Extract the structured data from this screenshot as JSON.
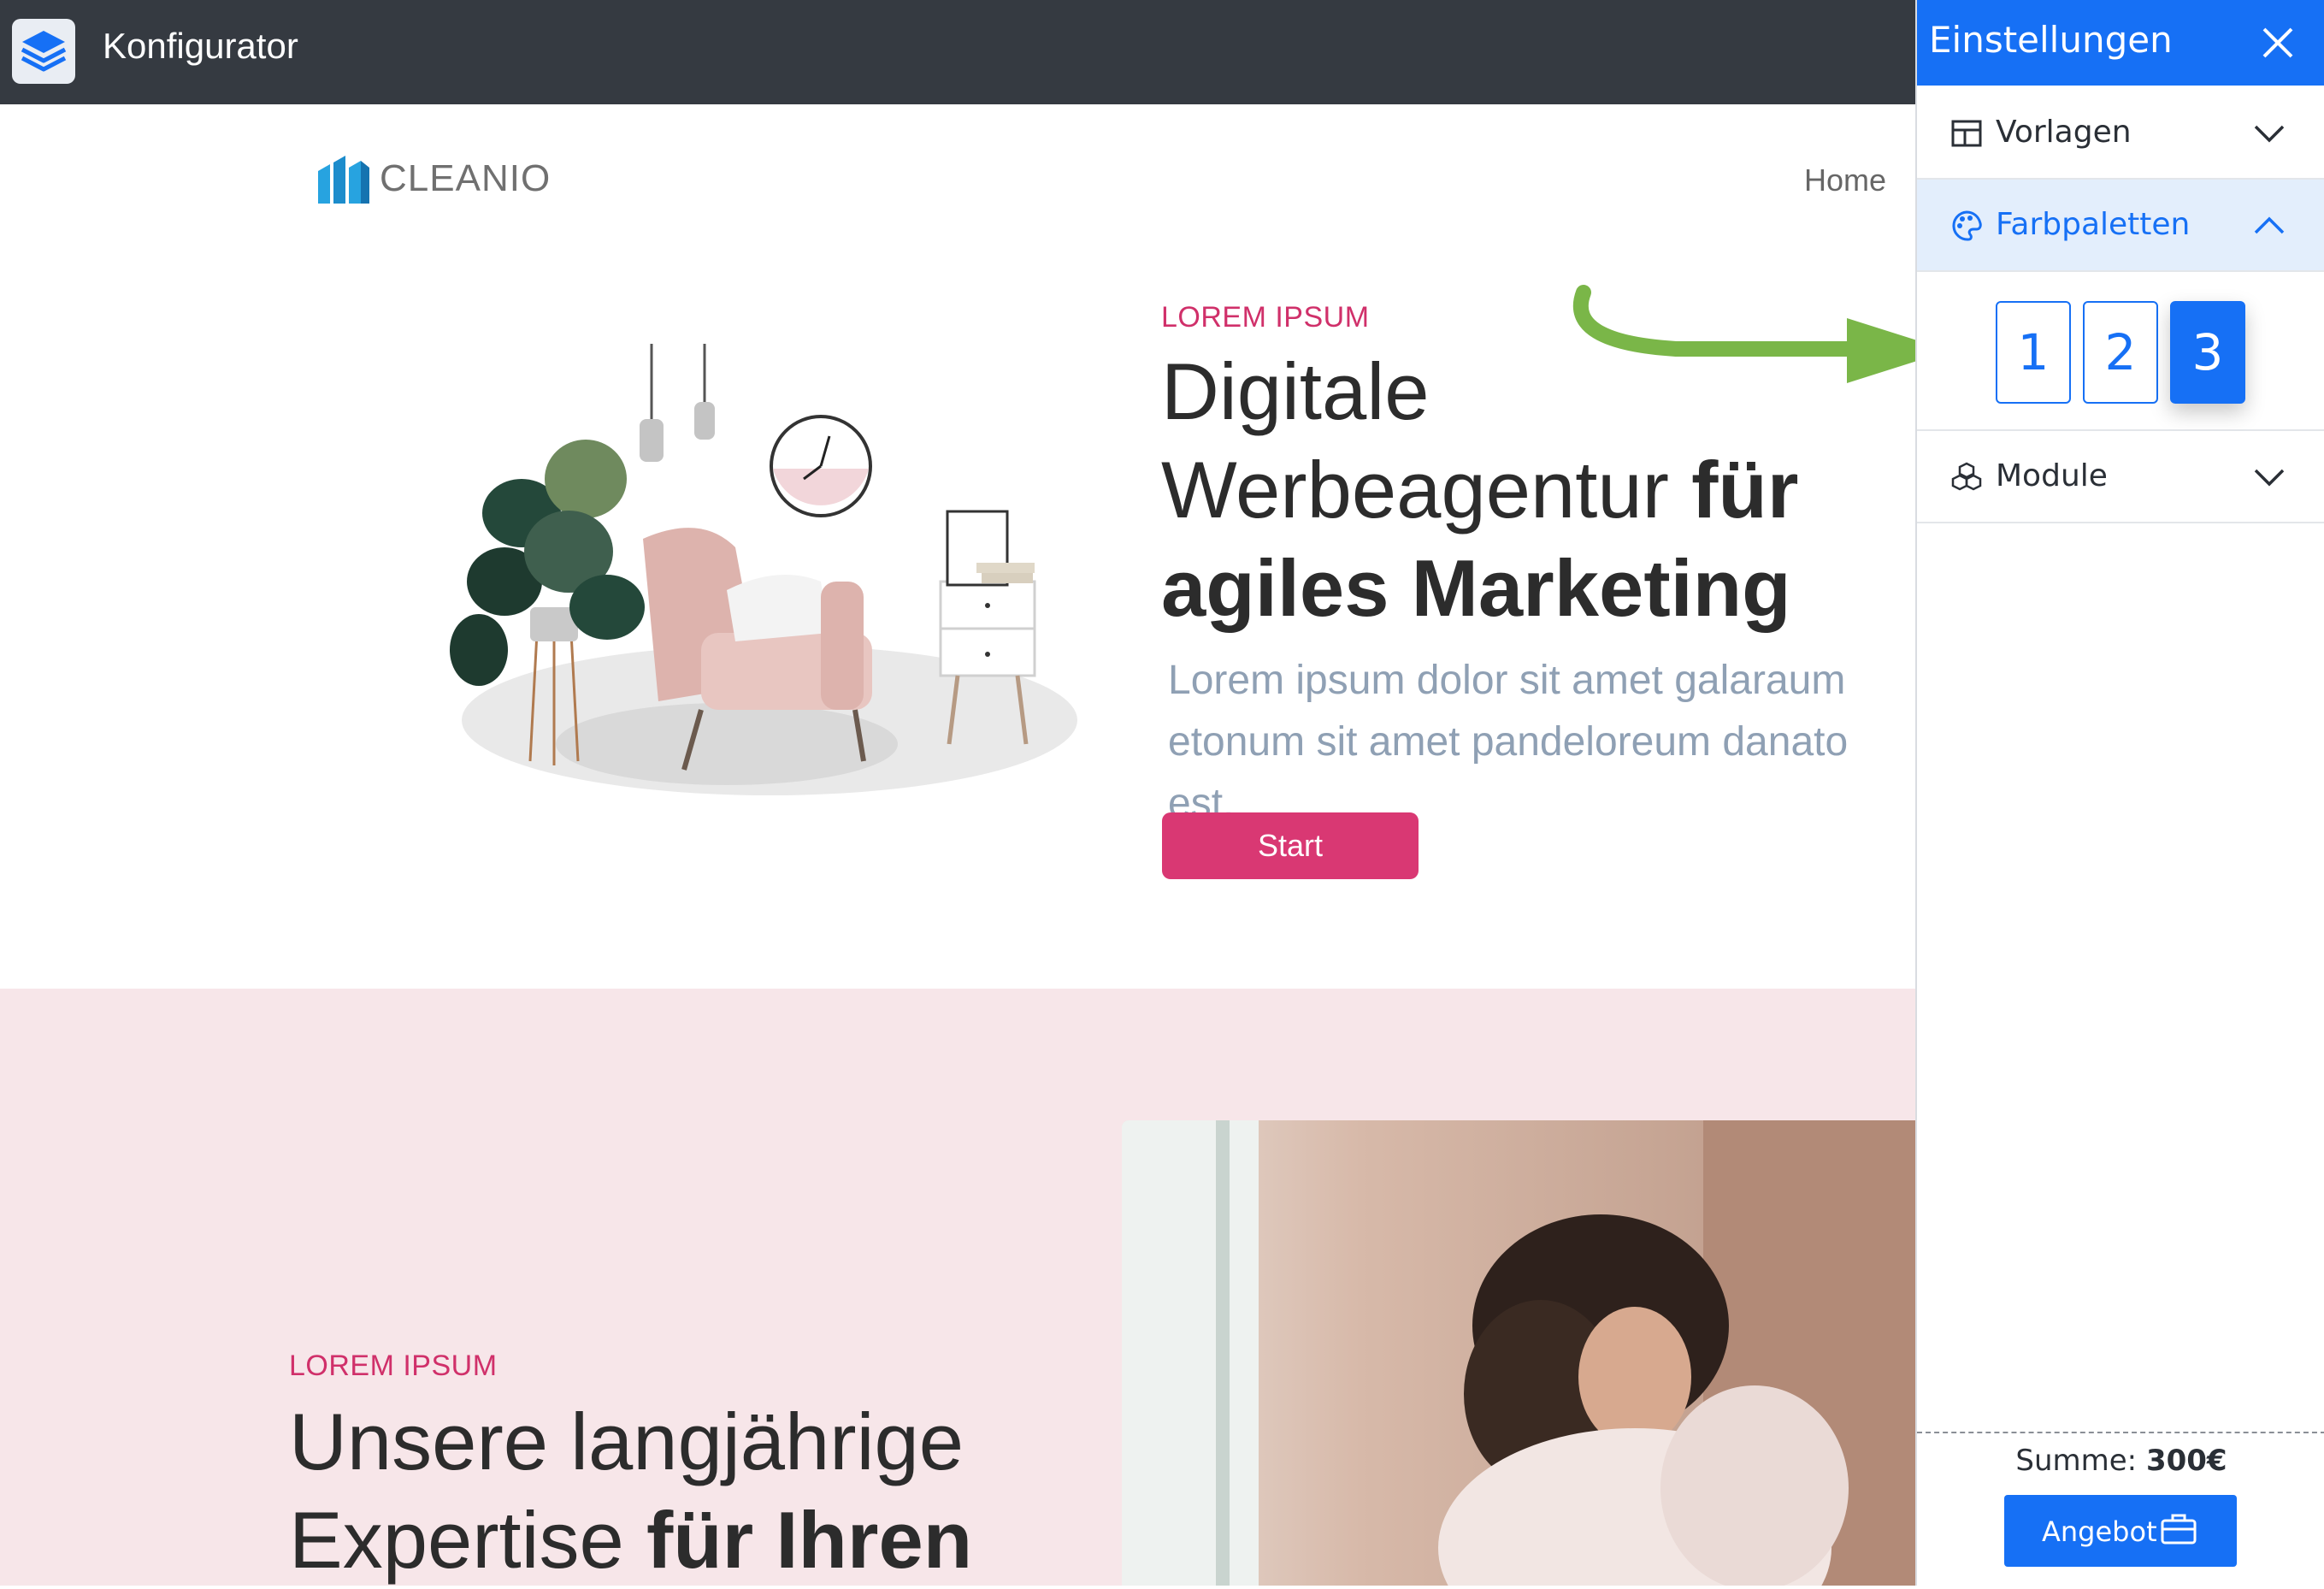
{
  "app": {
    "title": "Konfigurator"
  },
  "site": {
    "brand": "CLEANIO",
    "nav": {
      "home": "Home"
    },
    "hero": {
      "eyebrow": "LOREM IPSUM",
      "title_line1": "Digitale",
      "title_line2_regular": "Werbeagentur ",
      "title_line2_bold": "für",
      "title_line3_bold": "agiles Marketing",
      "text": "Lorem ipsum dolor sit amet galaraum etonum sit amet pandeloreum danato est.",
      "button": "Start"
    },
    "section2": {
      "eyebrow": "LOREM IPSUM",
      "title_line1": "Unsere langjährige",
      "title_line2_regular": "Expertise ",
      "title_line2_bold": "für Ihren"
    }
  },
  "panel": {
    "title": "Einstellungen",
    "items": [
      {
        "label": "Vorlagen",
        "icon": "layout-icon",
        "expanded": false
      },
      {
        "label": "Farbpaletten",
        "icon": "palette-icon",
        "expanded": true
      },
      {
        "label": "Module",
        "icon": "modules-icon",
        "expanded": false
      }
    ],
    "palettes": [
      "1",
      "2",
      "3"
    ],
    "selected_palette": "3",
    "sum_label": "Summe:",
    "sum_value": "300€",
    "offer_button": "Angebot"
  },
  "colors": {
    "appbar": "#353a41",
    "panel_accent": "#1670f5",
    "site_accent": "#d93873",
    "section2_bg": "#f7e6e9",
    "annotation_arrow": "#7ab648"
  }
}
